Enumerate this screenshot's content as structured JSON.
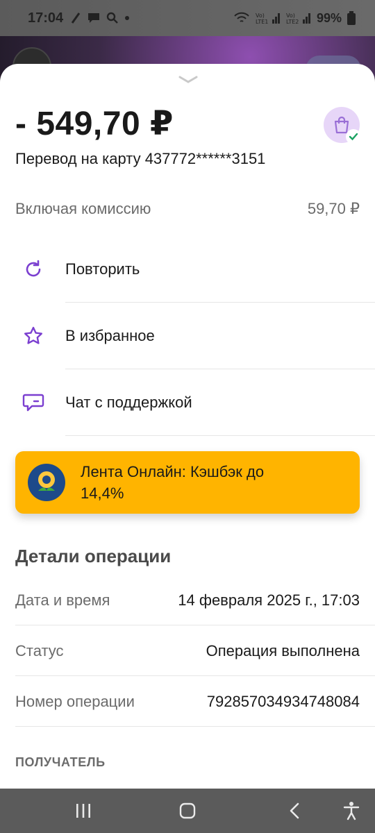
{
  "status_bar": {
    "time": "17:04",
    "battery": "99%",
    "left_icons": [
      "notification-icon",
      "chat-icon",
      "search-icon",
      "dot-icon"
    ],
    "right_icons": [
      "wifi-icon",
      "lte1-signal-icon",
      "lte2-signal-icon",
      "battery-icon"
    ]
  },
  "sheet": {
    "amount": "- 549,70 ₽",
    "subtitle": "Перевод на карту 437772******3151",
    "commission": {
      "label": "Включая комиссию",
      "value": "59,70 ₽"
    },
    "actions": [
      {
        "label": "Повторить",
        "icon": "repeat-icon"
      },
      {
        "label": "В избранное",
        "icon": "star-icon"
      },
      {
        "label": "Чат с поддержкой",
        "icon": "chat-support-icon"
      }
    ],
    "promo": {
      "text": "Лента Онлайн: Кэшбэк до 14,4%"
    },
    "details_title": "Детали операции",
    "details": [
      {
        "key": "Дата и время",
        "value": "14 февраля 2025 г., 17:03"
      },
      {
        "key": "Статус",
        "value": "Операция выполнена"
      },
      {
        "key": "Номер операции",
        "value": "79285703493474808​4"
      }
    ],
    "recipient_title": "ПОЛУЧАТЕЛЬ"
  },
  "navbar": {
    "buttons": [
      "recents-icon",
      "home-icon",
      "back-icon",
      "accessibility-icon"
    ]
  },
  "colors": {
    "accent": "#7b3fd0",
    "promo": "#ffb400",
    "badge_bg": "#e7d6f8",
    "check": "#1aa262"
  }
}
